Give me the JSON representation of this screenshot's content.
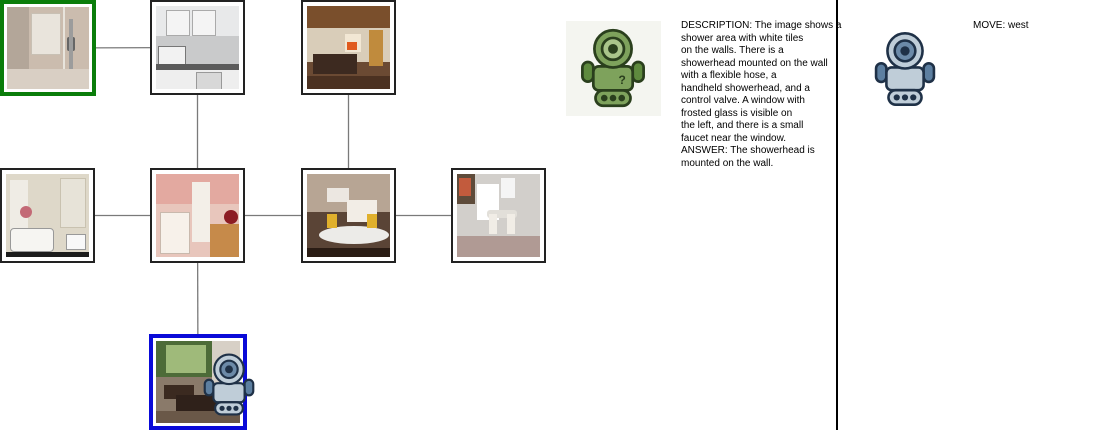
{
  "graph": {
    "nodes": [
      {
        "id": "shower",
        "scene": "shower",
        "status": "answered"
      },
      {
        "id": "kitchen",
        "scene": "kitchen"
      },
      {
        "id": "living-fireplace",
        "scene": "living-fireplace"
      },
      {
        "id": "bathroom",
        "scene": "bathroom"
      },
      {
        "id": "kids-bedroom",
        "scene": "kids-bedroom"
      },
      {
        "id": "lounge",
        "scene": "lounge"
      },
      {
        "id": "dining",
        "scene": "dining"
      },
      {
        "id": "office",
        "scene": "office",
        "status": "current"
      }
    ],
    "edges": [
      [
        "shower",
        "kitchen"
      ],
      [
        "kitchen",
        "kids-bedroom"
      ],
      [
        "living-fireplace",
        "lounge"
      ],
      [
        "bathroom",
        "kids-bedroom"
      ],
      [
        "kids-bedroom",
        "lounge"
      ],
      [
        "lounge",
        "dining"
      ],
      [
        "kids-bedroom",
        "office"
      ]
    ],
    "colors": {
      "answered": "#0a7d0a",
      "current": "#0a0ad8",
      "default": "#222222"
    }
  },
  "panel_description": {
    "text": "DESCRIPTION: The image shows a\nshower area with white tiles\non the walls. There is a\nshowerhead mounted on the wall\nwith a flexible hose, a\nhandheld showerhead, and a\ncontrol valve. A window with\nfrosted glass is visible on\nthe left, and there is a small\nfaucet near the window.\nANSWER: The showerhead is\nmounted on the wall.",
    "robot_icon": "green-robot-icon"
  },
  "panel_move": {
    "text": "MOVE: west",
    "robot_icon": "blue-robot-icon"
  }
}
